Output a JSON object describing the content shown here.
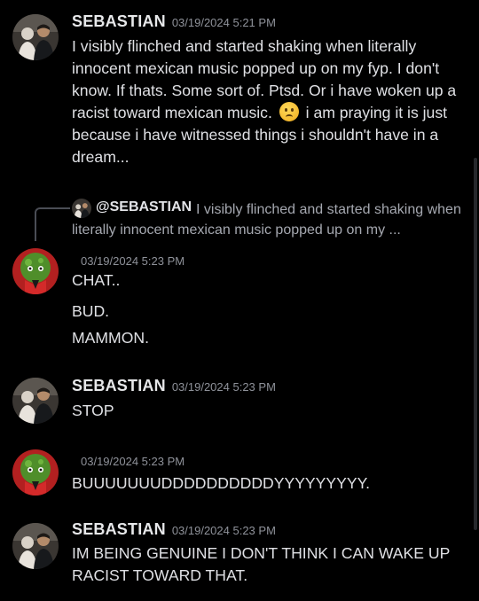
{
  "messages": [
    {
      "author": "SEBASTIAN",
      "timestamp": "03/19/2024 5:21 PM",
      "text_part1": "I visibly flinched and started shaking when literally innocent mexican music popped up on my fyp. I don't know. If thats. Some sort of. Ptsd. Or i have woken up a racist toward mexican music.",
      "emoji": "frowning-face-emoji",
      "text_part2": "i am praying it is just because i have witnessed things i shouldn't have in a dream..."
    },
    {
      "reply": {
        "author": "@SEBASTIAN",
        "preview": "I visibly flinched and started shaking when literally innocent mexican music popped up on my ..."
      },
      "author": "",
      "timestamp": "03/19/2024 5:23 PM",
      "lines": [
        "CHAT..",
        "BUD.",
        "MAMMON."
      ]
    },
    {
      "author": "SEBASTIAN",
      "timestamp": "03/19/2024 5:23 PM",
      "text": "STOP"
    },
    {
      "author": "",
      "timestamp": "03/19/2024 5:23 PM",
      "text": "BUUUUUUUDDDDDDDDDDYYYYYYYYY."
    },
    {
      "author": "SEBASTIAN",
      "timestamp": "03/19/2024 5:23 PM",
      "text": "IM BEING GENUINE I DON'T THINK I CAN WAKE UP RACIST TOWARD THAT."
    }
  ],
  "colors": {
    "background": "#000000",
    "username": "#e7e8ea",
    "timestamp": "#8f929a",
    "message_text": "#dfe0e4",
    "reply_preview": "#a5a8b0"
  }
}
